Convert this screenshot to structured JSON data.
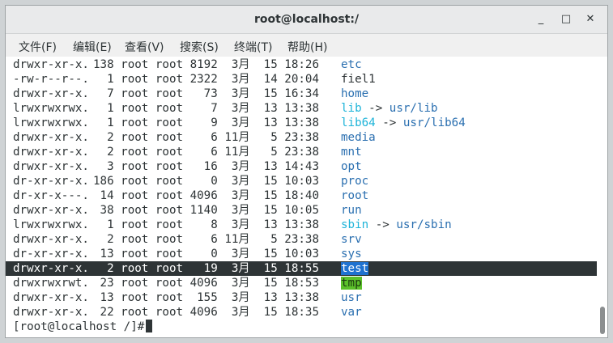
{
  "window": {
    "title": "root@localhost:/",
    "minimize_glyph": "_",
    "maximize_glyph": "□",
    "close_glyph": "✕"
  },
  "menu": [
    {
      "label": "文件(F)"
    },
    {
      "label": "编辑(E)"
    },
    {
      "label": "查看(V)"
    },
    {
      "label": "搜索(S)"
    },
    {
      "label": "终端(T)"
    },
    {
      "label": "帮助(H)"
    }
  ],
  "listing": [
    {
      "perm": "drwxr-xr-x.",
      "links": "138",
      "user": "root",
      "group": "root",
      "size": "8192",
      "month": "3月",
      "day": "15",
      "time": "18:26",
      "name": "etc",
      "type": "dir"
    },
    {
      "perm": "-rw-r--r--.",
      "links": "1",
      "user": "root",
      "group": "root",
      "size": "2322",
      "month": "3月",
      "day": "14",
      "time": "20:04",
      "name": "fiel1",
      "type": "file"
    },
    {
      "perm": "drwxr-xr-x.",
      "links": "7",
      "user": "root",
      "group": "root",
      "size": "73",
      "month": "3月",
      "day": "15",
      "time": "16:34",
      "name": "home",
      "type": "dir"
    },
    {
      "perm": "lrwxrwxrwx.",
      "links": "1",
      "user": "root",
      "group": "root",
      "size": "7",
      "month": "3月",
      "day": "13",
      "time": "13:38",
      "name": "lib",
      "type": "link",
      "target": "usr/lib"
    },
    {
      "perm": "lrwxrwxrwx.",
      "links": "1",
      "user": "root",
      "group": "root",
      "size": "9",
      "month": "3月",
      "day": "13",
      "time": "13:38",
      "name": "lib64",
      "type": "link",
      "target": "usr/lib64"
    },
    {
      "perm": "drwxr-xr-x.",
      "links": "2",
      "user": "root",
      "group": "root",
      "size": "6",
      "month": "11月",
      "day": "5",
      "time": "23:38",
      "name": "media",
      "type": "dir"
    },
    {
      "perm": "drwxr-xr-x.",
      "links": "2",
      "user": "root",
      "group": "root",
      "size": "6",
      "month": "11月",
      "day": "5",
      "time": "23:38",
      "name": "mnt",
      "type": "dir"
    },
    {
      "perm": "drwxr-xr-x.",
      "links": "3",
      "user": "root",
      "group": "root",
      "size": "16",
      "month": "3月",
      "day": "13",
      "time": "14:43",
      "name": "opt",
      "type": "dir"
    },
    {
      "perm": "dr-xr-xr-x.",
      "links": "186",
      "user": "root",
      "group": "root",
      "size": "0",
      "month": "3月",
      "day": "15",
      "time": "10:03",
      "name": "proc",
      "type": "dir"
    },
    {
      "perm": "dr-xr-x---.",
      "links": "14",
      "user": "root",
      "group": "root",
      "size": "4096",
      "month": "3月",
      "day": "15",
      "time": "18:40",
      "name": "root",
      "type": "dir"
    },
    {
      "perm": "drwxr-xr-x.",
      "links": "38",
      "user": "root",
      "group": "root",
      "size": "1140",
      "month": "3月",
      "day": "15",
      "time": "10:05",
      "name": "run",
      "type": "dir"
    },
    {
      "perm": "lrwxrwxrwx.",
      "links": "1",
      "user": "root",
      "group": "root",
      "size": "8",
      "month": "3月",
      "day": "13",
      "time": "13:38",
      "name": "sbin",
      "type": "link",
      "target": "usr/sbin"
    },
    {
      "perm": "drwxr-xr-x.",
      "links": "2",
      "user": "root",
      "group": "root",
      "size": "6",
      "month": "11月",
      "day": "5",
      "time": "23:38",
      "name": "srv",
      "type": "dir"
    },
    {
      "perm": "dr-xr-xr-x.",
      "links": "13",
      "user": "root",
      "group": "root",
      "size": "0",
      "month": "3月",
      "day": "15",
      "time": "10:03",
      "name": "sys",
      "type": "dir"
    },
    {
      "perm": "drwxr-xr-x.",
      "links": "2",
      "user": "root",
      "group": "root",
      "size": "19",
      "month": "3月",
      "day": "15",
      "time": "18:55",
      "name": "test",
      "type": "selected"
    },
    {
      "perm": "drwxrwxrwt.",
      "links": "23",
      "user": "root",
      "group": "root",
      "size": "4096",
      "month": "3月",
      "day": "15",
      "time": "18:53",
      "name": "tmp",
      "type": "sticky"
    },
    {
      "perm": "drwxr-xr-x.",
      "links": "13",
      "user": "root",
      "group": "root",
      "size": "155",
      "month": "3月",
      "day": "13",
      "time": "13:38",
      "name": "usr",
      "type": "dir"
    },
    {
      "perm": "drwxr-xr-x.",
      "links": "22",
      "user": "root",
      "group": "root",
      "size": "4096",
      "month": "3月",
      "day": "15",
      "time": "18:35",
      "name": "var",
      "type": "dir"
    }
  ],
  "prompt": "[root@localhost /]#",
  "arrow": "->",
  "colors": {
    "dir": "#2a6fb0",
    "link": "#1eb4d9",
    "selection_bg": "#2e3436",
    "selected_name_bg": "#1f72d0",
    "sticky_bg": "#5bc02a"
  }
}
